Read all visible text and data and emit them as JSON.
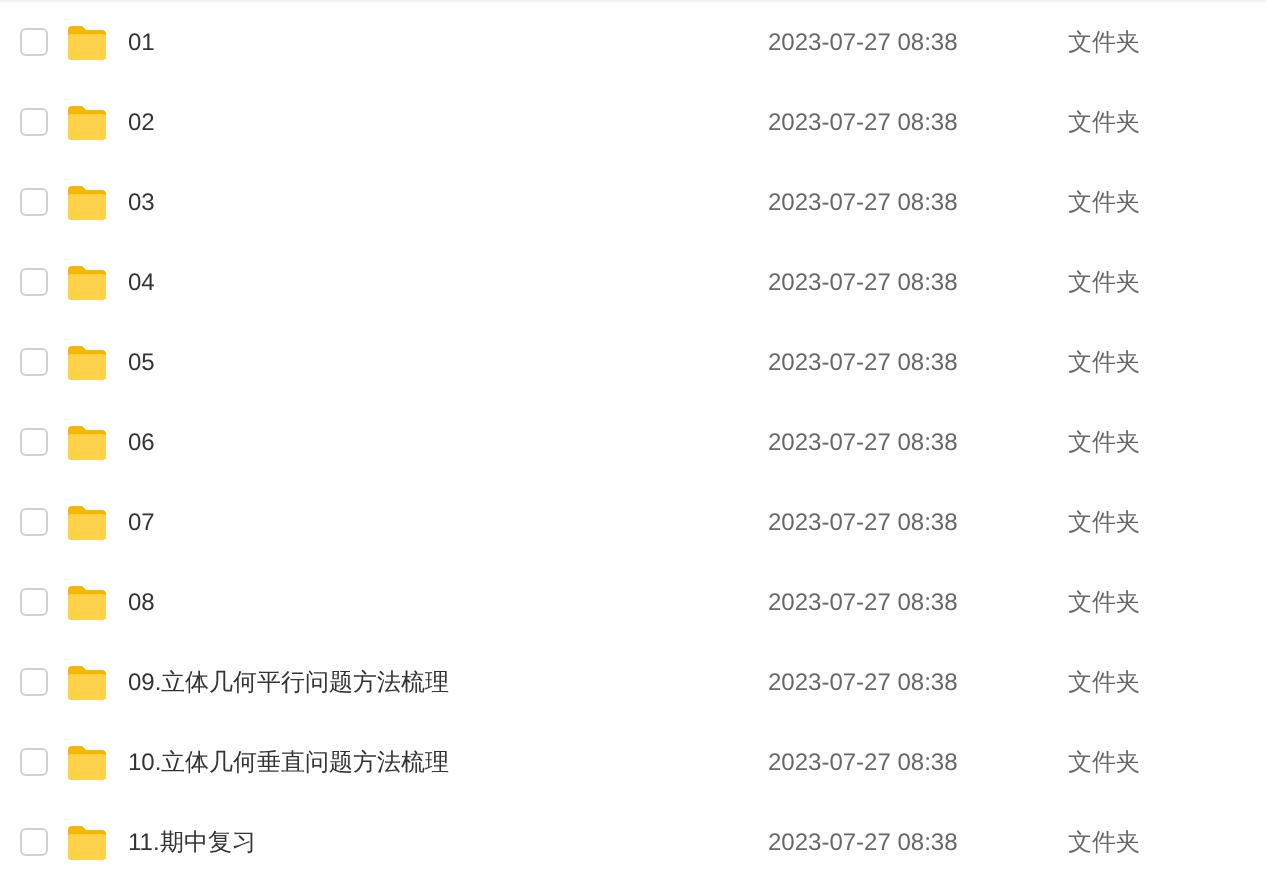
{
  "files": [
    {
      "name": "01",
      "modified": "2023-07-27 08:38",
      "type": "文件夹",
      "checked": false
    },
    {
      "name": "02",
      "modified": "2023-07-27 08:38",
      "type": "文件夹",
      "checked": false
    },
    {
      "name": "03",
      "modified": "2023-07-27 08:38",
      "type": "文件夹",
      "checked": false
    },
    {
      "name": "04",
      "modified": "2023-07-27 08:38",
      "type": "文件夹",
      "checked": false
    },
    {
      "name": "05",
      "modified": "2023-07-27 08:38",
      "type": "文件夹",
      "checked": false
    },
    {
      "name": "06",
      "modified": "2023-07-27 08:38",
      "type": "文件夹",
      "checked": false
    },
    {
      "name": "07",
      "modified": "2023-07-27 08:38",
      "type": "文件夹",
      "checked": false
    },
    {
      "name": "08",
      "modified": "2023-07-27 08:38",
      "type": "文件夹",
      "checked": false
    },
    {
      "name": "09.立体几何平行问题方法梳理",
      "modified": "2023-07-27 08:38",
      "type": "文件夹",
      "checked": false
    },
    {
      "name": "10.立体几何垂直问题方法梳理",
      "modified": "2023-07-27 08:38",
      "type": "文件夹",
      "checked": false
    },
    {
      "name": "11.期中复习",
      "modified": "2023-07-27 08:38",
      "type": "文件夹",
      "checked": false
    }
  ]
}
